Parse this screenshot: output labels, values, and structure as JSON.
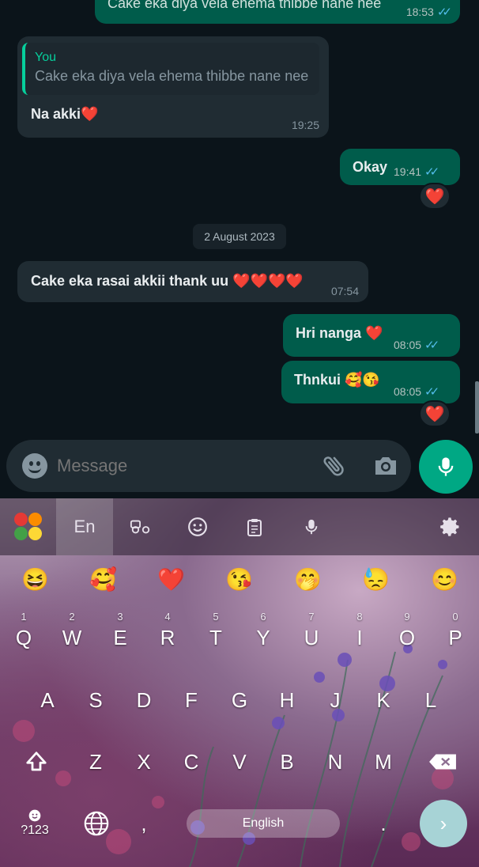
{
  "messages": [
    {
      "id": "m0",
      "dir": "out",
      "text": "Cake eka  diya vela ehema thibbe nane nee",
      "time": "18:53",
      "partial": true
    },
    {
      "id": "m1",
      "dir": "in",
      "quote_author": "You",
      "quote_text": "Cake eka  diya vela ehema thibbe nane nee",
      "text": "Na akki",
      "emoji": "❤️",
      "time": "19:25"
    },
    {
      "id": "m2",
      "dir": "out",
      "text": "Okay",
      "time": "19:41",
      "reaction": "❤️"
    },
    {
      "id": "m3",
      "dir": "in",
      "text": "Cake eka rasai akkii thank uu",
      "emoji": "❤️❤️❤️❤️",
      "time": "07:54"
    },
    {
      "id": "m4",
      "dir": "out",
      "text": "Hri nanga",
      "emoji": "❤️",
      "time": "08:05"
    },
    {
      "id": "m5",
      "dir": "out",
      "text": "Thnkui",
      "emoji": "🥰😘",
      "time": "08:05",
      "reaction": "❤️"
    }
  ],
  "date_separator": "2 August 2023",
  "ticks": "✓✓",
  "composer": {
    "placeholder": "Message"
  },
  "keyboard": {
    "lang_tab": "En",
    "emoji_suggestions": [
      "😆",
      "🥰",
      "❤️",
      "😘",
      "🤭",
      "😓",
      "😊"
    ],
    "row1": [
      {
        "num": "1",
        "letter": "Q"
      },
      {
        "num": "2",
        "letter": "W"
      },
      {
        "num": "3",
        "letter": "E"
      },
      {
        "num": "4",
        "letter": "R"
      },
      {
        "num": "5",
        "letter": "T"
      },
      {
        "num": "6",
        "letter": "Y"
      },
      {
        "num": "7",
        "letter": "U"
      },
      {
        "num": "8",
        "letter": "I"
      },
      {
        "num": "9",
        "letter": "O"
      },
      {
        "num": "0",
        "letter": "P"
      }
    ],
    "row2": [
      "A",
      "S",
      "D",
      "F",
      "G",
      "H",
      "J",
      "K",
      "L"
    ],
    "row3": [
      "Z",
      "X",
      "C",
      "V",
      "B",
      "N",
      "M"
    ],
    "symbols_key": "?123",
    "comma": ",",
    "period": ".",
    "space_label": "English",
    "enter_symbol": "›"
  },
  "colors": {
    "app_bg": "#0b141a",
    "outgoing": "#005c4b",
    "incoming": "#202c33",
    "accent": "#00a884",
    "read_ticks": "#53bdeb"
  }
}
